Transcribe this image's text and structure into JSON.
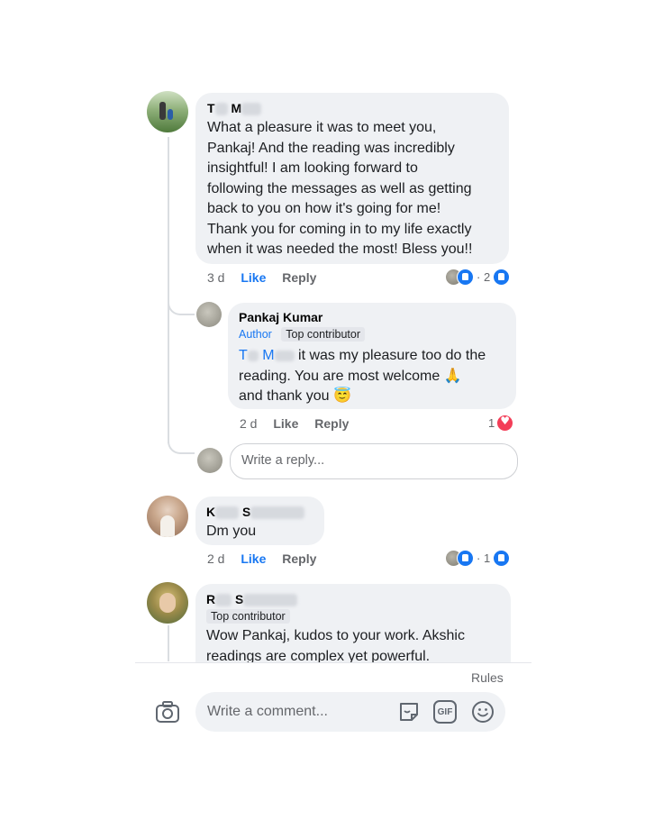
{
  "comments": [
    {
      "author_initials": [
        "T",
        "M"
      ],
      "text_lines": [
        "What a pleasure it was to meet you,",
        "Pankaj!  And the reading was incredibly",
        "insightful!  I am looking forward to",
        "following the messages as well as getting",
        "back to you on how it's going for me!",
        "Thank you for coming in to my life exactly",
        "when it was needed the most!  Bless you!!"
      ],
      "time": "3 d",
      "like_label": "Like",
      "reply_label": "Reply",
      "reaction_count": "· 2"
    },
    {
      "author_name": "Pankaj Kumar",
      "author_badge": "Author",
      "contributor_badge": "Top contributor",
      "mention_initials": [
        "T",
        "M"
      ],
      "text_line1_rest": "it was my pleasure too do the",
      "text_line2": "reading. You are most welcome 🙏",
      "text_line3": "and thank you 😇",
      "time": "2 d",
      "like_label": "Like",
      "reply_label": "Reply",
      "reaction_count": "1"
    },
    {
      "author_initials": [
        "K",
        "S"
      ],
      "text": "Dm you",
      "time": "2 d",
      "like_label": "Like",
      "reply_label": "Reply",
      "reaction_count": "· 1"
    },
    {
      "author_initials": [
        "R",
        "S"
      ],
      "contributor_badge": "Top contributor",
      "text_line1": "Wow Pankaj, kudos to your work. Akshic",
      "text_line2": "readings are complex yet powerful."
    }
  ],
  "reply_input": {
    "placeholder": "Write a reply..."
  },
  "rules_link": "Rules",
  "comment_bar": {
    "placeholder": "Write a comment...",
    "gif_label": "GIF",
    "icons": [
      "camera-icon",
      "sticker-icon",
      "gif-icon",
      "emoji-icon"
    ]
  },
  "colors": {
    "link_blue": "#1877f2",
    "bubble_grey": "#eff1f4",
    "heart_red": "#f33e58"
  }
}
